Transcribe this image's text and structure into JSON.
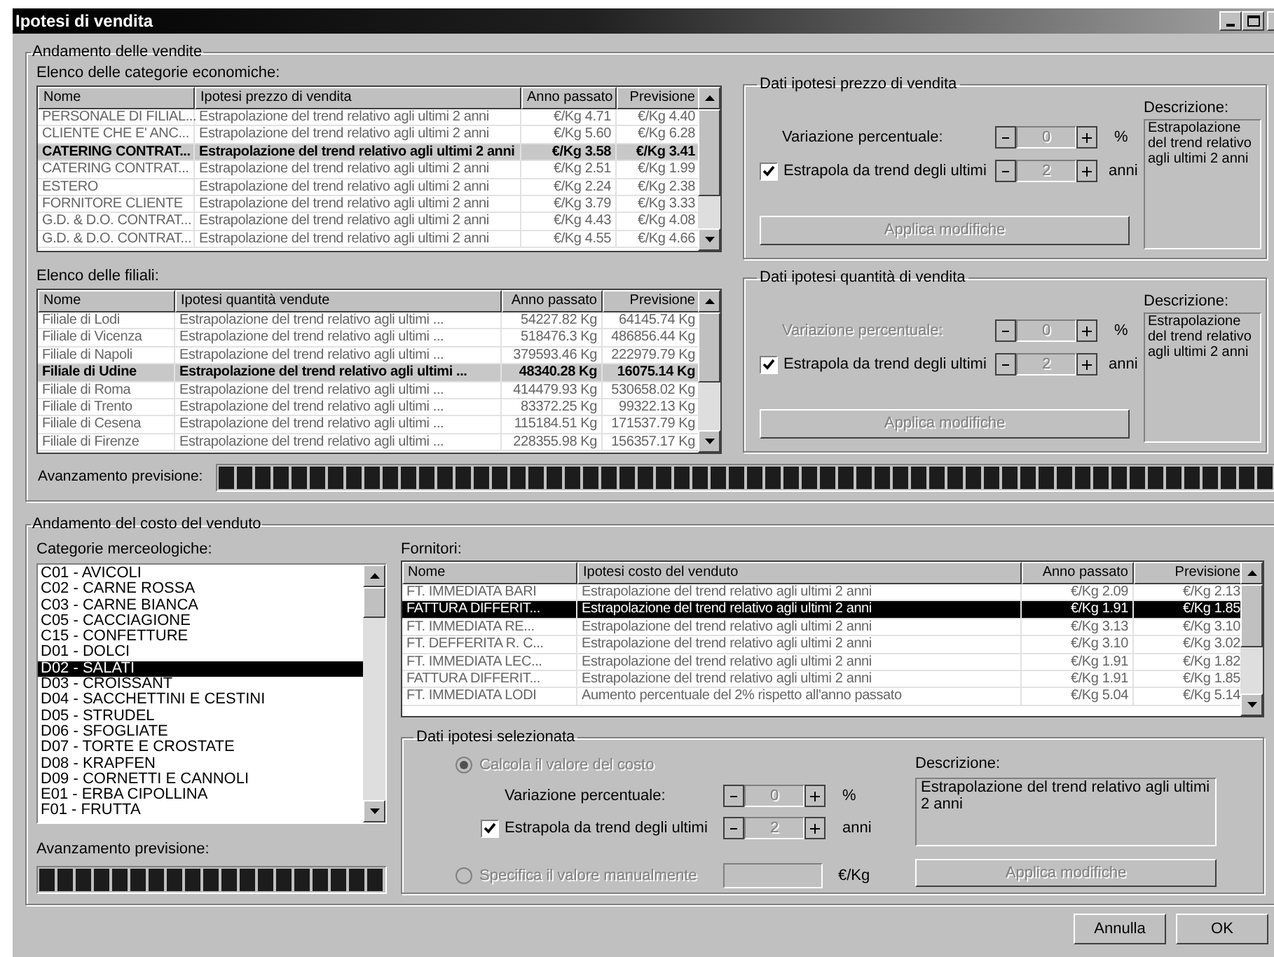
{
  "window": {
    "title": "Ipotesi di vendita"
  },
  "sales": {
    "title": "Andamento delle vendite",
    "categories": {
      "label": "Elenco delle categorie economiche:",
      "columns": [
        "Nome",
        "Ipotesi prezzo di vendita",
        "Anno passato",
        "Previsione"
      ],
      "rows": [
        {
          "cells": [
            "PERSONALE DI FILIAL...",
            "Estrapolazione del trend relativo agli ultimi 2 anni",
            "€/Kg 4.71",
            "€/Kg 4.40"
          ],
          "selected": false
        },
        {
          "cells": [
            "CLIENTE CHE E' ANC...",
            "Estrapolazione del trend relativo agli ultimi 2 anni",
            "€/Kg 5.60",
            "€/Kg 6.28"
          ],
          "selected": false
        },
        {
          "cells": [
            "CATERING CONTRAT...",
            "Estrapolazione del trend relativo agli ultimi 2 anni",
            "€/Kg 3.58",
            "€/Kg 3.41"
          ],
          "selected": true
        },
        {
          "cells": [
            "CATERING CONTRAT...",
            "Estrapolazione del trend relativo agli ultimi 2 anni",
            "€/Kg 2.51",
            "€/Kg 1.99"
          ],
          "selected": false
        },
        {
          "cells": [
            "ESTERO",
            "Estrapolazione del trend relativo agli ultimi 2 anni",
            "€/Kg 2.24",
            "€/Kg 2.38"
          ],
          "selected": false
        },
        {
          "cells": [
            "FORNITORE CLIENTE",
            "Estrapolazione del trend relativo agli ultimi 2 anni",
            "€/Kg 3.79",
            "€/Kg 3.33"
          ],
          "selected": false
        },
        {
          "cells": [
            "G.D. & D.O. CONTRAT...",
            "Estrapolazione del trend relativo agli ultimi 2 anni",
            "€/Kg 4.43",
            "€/Kg 4.08"
          ],
          "selected": false
        },
        {
          "cells": [
            "G.D. & D.O. CONTRAT...",
            "Estrapolazione del trend relativo agli ultimi 2 anni",
            "€/Kg 4.55",
            "€/Kg 4.66"
          ],
          "selected": false
        }
      ]
    },
    "price_panel": {
      "title": "Dati ipotesi prezzo di vendita",
      "variation": {
        "label": "Variazione percentuale:",
        "label_disabled": false,
        "spinner": {
          "value": "0",
          "disabled": true
        },
        "unit": "%"
      },
      "trend": {
        "label": "Estrapola da trend degli ultimi",
        "checked": true,
        "spinner": {
          "value": "2",
          "disabled": true
        },
        "unit": "anni"
      },
      "description": {
        "label": "Descrizione:",
        "text": "Estrapolazione del trend relativo agli ultimi 2 anni"
      },
      "apply": {
        "label": "Applica modifiche",
        "disabled": true
      }
    },
    "branches": {
      "label": "Elenco delle filiali:",
      "columns": [
        "Nome",
        "Ipotesi quantità vendute",
        "Anno passato",
        "Previsione"
      ],
      "rows": [
        {
          "cells": [
            "Filiale di Lodi",
            "Estrapolazione del trend relativo agli ultimi ...",
            "54227.82 Kg",
            "64145.74 Kg"
          ],
          "selected": false
        },
        {
          "cells": [
            "Filiale di Vicenza",
            "Estrapolazione del trend relativo agli ultimi ...",
            "518476.3 Kg",
            "486856.44 Kg"
          ],
          "selected": false
        },
        {
          "cells": [
            "Filiale di Napoli",
            "Estrapolazione del trend relativo agli ultimi ...",
            "379593.46 Kg",
            "222979.79 Kg"
          ],
          "selected": false
        },
        {
          "cells": [
            "Filiale di Udine",
            "Estrapolazione del trend relativo agli ultimi ...",
            "48340.28 Kg",
            "16075.14 Kg"
          ],
          "selected": true
        },
        {
          "cells": [
            "Filiale di Roma",
            "Estrapolazione del trend relativo agli ultimi ...",
            "414479.93 Kg",
            "530658.02 Kg"
          ],
          "selected": false
        },
        {
          "cells": [
            "Filiale di Trento",
            "Estrapolazione del trend relativo agli ultimi ...",
            "83372.25 Kg",
            "99322.13 Kg"
          ],
          "selected": false
        },
        {
          "cells": [
            "Filiale di Cesena",
            "Estrapolazione del trend relativo agli ultimi ...",
            "115184.51 Kg",
            "171537.79 Kg"
          ],
          "selected": false
        },
        {
          "cells": [
            "Filiale di Firenze",
            "Estrapolazione del trend relativo agli ultimi ...",
            "228355.98 Kg",
            "156357.17 Kg"
          ],
          "selected": false
        }
      ]
    },
    "quantity_panel": {
      "title": "Dati ipotesi quantità di vendita",
      "variation": {
        "label": "Variazione percentuale:",
        "label_disabled": true,
        "spinner": {
          "value": "0",
          "disabled": true
        },
        "unit": "%"
      },
      "trend": {
        "label": "Estrapola da trend degli ultimi",
        "checked": true,
        "spinner": {
          "value": "2",
          "disabled": true
        },
        "unit": "anni"
      },
      "description": {
        "label": "Descrizione:",
        "text": "Estrapolazione del trend relativo agli ultimi 2 anni"
      },
      "apply": {
        "label": "Applica modifiche",
        "disabled": true
      }
    },
    "progress": {
      "label": "Avanzamento previsione:",
      "level": 1
    }
  },
  "cost": {
    "title": "Andamento del costo del venduto",
    "merch": {
      "label": "Categorie merceologiche:",
      "items": [
        {
          "label": "C01 - AVICOLI",
          "selected": false
        },
        {
          "label": "C02 - CARNE ROSSA",
          "selected": false
        },
        {
          "label": "C03 - CARNE BIANCA",
          "selected": false
        },
        {
          "label": "C05 - CACCIAGIONE",
          "selected": false
        },
        {
          "label": "C15 - CONFETTURE",
          "selected": false
        },
        {
          "label": "D01 - DOLCI",
          "selected": false
        },
        {
          "label": "D02 - SALATI",
          "selected": true
        },
        {
          "label": "D03 - CROISSANT",
          "selected": false
        },
        {
          "label": "D04 - SACCHETTINI E CESTINI",
          "selected": false
        },
        {
          "label": "D05 - STRUDEL",
          "selected": false
        },
        {
          "label": "D06 - SFOGLIATE",
          "selected": false
        },
        {
          "label": "D07 - TORTE E CROSTATE",
          "selected": false
        },
        {
          "label": "D08 - KRAPFEN",
          "selected": false
        },
        {
          "label": "D09 - CORNETTI E CANNOLI",
          "selected": false
        },
        {
          "label": "E01 - ERBA CIPOLLINA",
          "selected": false
        },
        {
          "label": "F01 - FRUTTA",
          "selected": false
        }
      ]
    },
    "progress": {
      "label": "Avanzamento previsione:",
      "level": 1
    },
    "suppliers": {
      "label": "Fornitori:",
      "columns": [
        "Nome",
        "Ipotesi costo del venduto",
        "Anno passato",
        "Previsione"
      ],
      "rows": [
        {
          "cells": [
            "FT. IMMEDIATA BARI",
            "Estrapolazione del trend relativo agli ultimi 2 anni",
            "€/Kg 2.09",
            "€/Kg 2.13"
          ],
          "selected": false
        },
        {
          "cells": [
            "FATTURA DIFFERIT...",
            "Estrapolazione del trend relativo agli ultimi 2 anni",
            "€/Kg 1.91",
            "€/Kg 1.85"
          ],
          "selected": true
        },
        {
          "cells": [
            "FT. IMMEDIATA RE...",
            "Estrapolazione del trend relativo agli ultimi 2 anni",
            "€/Kg 3.13",
            "€/Kg 3.10"
          ],
          "selected": false
        },
        {
          "cells": [
            "FT. DEFFERITA R. C...",
            "Estrapolazione del trend relativo agli ultimi 2 anni",
            "€/Kg 3.10",
            "€/Kg 3.02"
          ],
          "selected": false
        },
        {
          "cells": [
            "FT. IMMEDIATA LEC...",
            "Estrapolazione del trend relativo agli ultimi 2 anni",
            "€/Kg 1.91",
            "€/Kg 1.82"
          ],
          "selected": false
        },
        {
          "cells": [
            "FATTURA DIFFERIT...",
            "Estrapolazione del trend relativo agli ultimi 2 anni",
            "€/Kg 1.91",
            "€/Kg 1.85"
          ],
          "selected": false
        },
        {
          "cells": [
            "FT. IMMEDIATA LODI",
            "Aumento percentuale del 2% rispetto all'anno passato",
            "€/Kg 5.04",
            "€/Kg 5.14"
          ],
          "selected": false
        }
      ]
    },
    "selected_panel": {
      "title": "Dati ipotesi selezionata",
      "modes": [
        {
          "label": "Calcola il valore del costo",
          "selected": true,
          "disabled": true
        },
        {
          "label": "Specifica il valore manualmente",
          "selected": false,
          "disabled": true
        }
      ],
      "variation": {
        "label": "Variazione percentuale:",
        "label_disabled": false,
        "spinner": {
          "value": "0",
          "disabled": true
        },
        "unit": "%"
      },
      "trend": {
        "label": "Estrapola da trend degli ultimi",
        "checked": true,
        "spinner": {
          "value": "2",
          "disabled": true
        },
        "unit": "anni"
      },
      "manual_unit": "€/Kg",
      "description": {
        "label": "Descrizione:",
        "text": "Estrapolazione del trend relativo agli ultimi 2 anni"
      },
      "apply": {
        "label": "Applica modifiche",
        "disabled": true
      }
    }
  },
  "buttons": [
    {
      "label": "Annulla"
    },
    {
      "label": "OK"
    }
  ]
}
